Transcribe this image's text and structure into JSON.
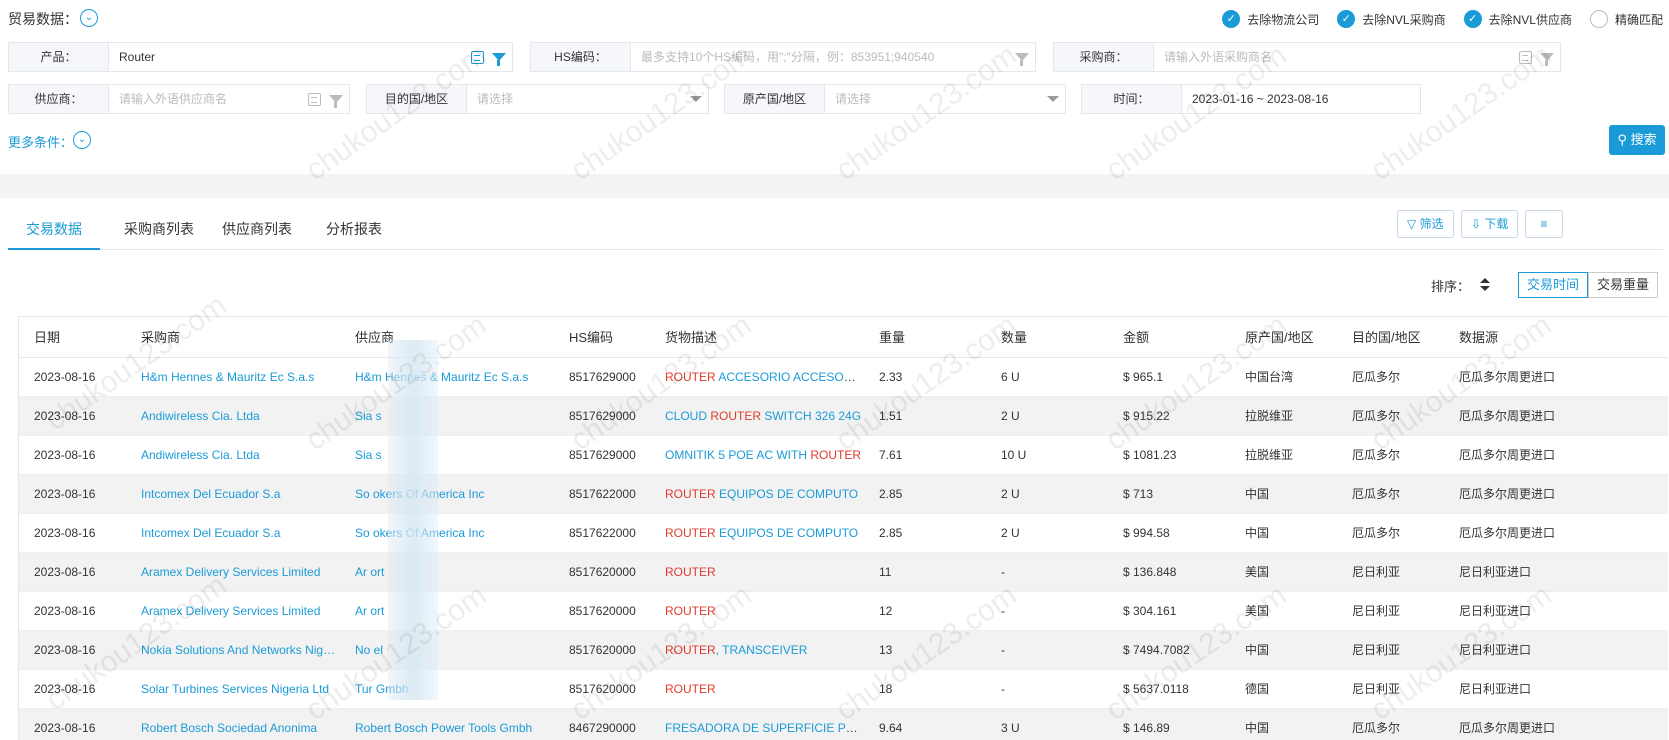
{
  "header": {
    "title": "贸易数据：",
    "options": [
      {
        "label": "去除物流公司",
        "checked": true
      },
      {
        "label": "去除NVL采购商",
        "checked": true
      },
      {
        "label": "去除NVL供应商",
        "checked": true
      },
      {
        "label": "精确匹配",
        "checked": false
      }
    ]
  },
  "filters": {
    "product": {
      "label": "产品：",
      "value": "Router"
    },
    "hs": {
      "label": "HS编码：",
      "placeholder": "最多支持10个HS编码，用\";\"分隔，例：853951;940540"
    },
    "buyer": {
      "label": "采购商：",
      "placeholder": "请输入外语采购商名"
    },
    "supplier": {
      "label": "供应商：",
      "placeholder": "请输入外语供应商名"
    },
    "destination": {
      "label": "目的国/地区",
      "placeholder": "请选择"
    },
    "origin": {
      "label": "原产国/地区",
      "placeholder": "请选择"
    },
    "time": {
      "label": "时间：",
      "value": "2023-01-16 ~ 2023-08-16"
    }
  },
  "more_conditions": "更多条件：",
  "search_label": "搜索",
  "tabs": [
    {
      "label": "交易数据",
      "active": true
    },
    {
      "label": "采购商列表",
      "active": false
    },
    {
      "label": "供应商列表",
      "active": false
    },
    {
      "label": "分析报表",
      "active": false
    }
  ],
  "toolbar": {
    "filter_label": "筛选",
    "download_label": "下载"
  },
  "sort": {
    "label": "排序：",
    "options": [
      "交易时间",
      "交易重量"
    ],
    "active": "交易时间"
  },
  "watermark": "chukou123.com",
  "table": {
    "columns": [
      "日期",
      "采购商",
      "供应商",
      "HS编码",
      "货物描述",
      "重量",
      "数量",
      "金额",
      "原产国/地区",
      "目的国/地区",
      "数据源"
    ],
    "rows": [
      {
        "date": "2023-08-16",
        "buyer": "H&m Hennes & Mauritz Ec S.a.s",
        "supplier": "H&m Hennes & Mauritz Ec S.a.s",
        "hs": "8517629000",
        "desc_kw": "ROUTER",
        "desc_rest": " ACCESORIO ACCESORIO",
        "weight": "2.33",
        "qty": "6 U",
        "amount": "$ 965.1",
        "origin": "中国台湾",
        "dest": "厄瓜多尔",
        "source": "厄瓜多尔周更进口"
      },
      {
        "date": "2023-08-16",
        "buyer": "Andiwireless Cia. Ltda",
        "supplier": "Sia                s",
        "hs": "8517629000",
        "desc_pre": "CLOUD ",
        "desc_kw": "ROUTER",
        "desc_rest": " SWITCH 326 24G",
        "weight": "1.51",
        "qty": "2 U",
        "amount": "$ 915.22",
        "origin": "拉脱维亚",
        "dest": "厄瓜多尔",
        "source": "厄瓜多尔周更进口"
      },
      {
        "date": "2023-08-16",
        "buyer": "Andiwireless Cia. Ltda",
        "supplier": "Sia                s",
        "hs": "8517629000",
        "desc_pre": "OMNITIK 5 POE AC WITH ",
        "desc_kw": "ROUTER",
        "desc_rest": "",
        "weight": "7.61",
        "qty": "10 U",
        "amount": "$ 1081.23",
        "origin": "拉脱维亚",
        "dest": "厄瓜多尔",
        "source": "厄瓜多尔周更进口"
      },
      {
        "date": "2023-08-16",
        "buyer": "Intcomex Del Ecuador S.a",
        "supplier": "So              okers Of America Inc",
        "hs": "8517622000",
        "desc_kw": "ROUTER",
        "desc_rest": " EQUIPOS DE COMPUTO",
        "weight": "2.85",
        "qty": "2 U",
        "amount": "$ 713",
        "origin": "中国",
        "dest": "厄瓜多尔",
        "source": "厄瓜多尔周更进口"
      },
      {
        "date": "2023-08-16",
        "buyer": "Intcomex Del Ecuador S.a",
        "supplier": "So              okers Of America Inc",
        "hs": "8517622000",
        "desc_kw": "ROUTER",
        "desc_rest": " EQUIPOS DE COMPUTO",
        "weight": "2.85",
        "qty": "2 U",
        "amount": "$ 994.58",
        "origin": "中国",
        "dest": "厄瓜多尔",
        "source": "厄瓜多尔周更进口"
      },
      {
        "date": "2023-08-16",
        "buyer": "Aramex Delivery Services Limited",
        "supplier": "Ar               ort",
        "hs": "8517620000",
        "desc_kw": "ROUTER",
        "desc_rest": "",
        "weight": "11",
        "qty": "-",
        "amount": "$ 136.848",
        "origin": "美国",
        "dest": "尼日利亚",
        "source": "尼日利亚进口"
      },
      {
        "date": "2023-08-16",
        "buyer": "Aramex Delivery Services Limited",
        "supplier": "Ar               ort",
        "hs": "8517620000",
        "desc_kw": "ROUTER",
        "desc_rest": "",
        "weight": "12",
        "qty": "-",
        "amount": "$ 304.161",
        "origin": "美国",
        "dest": "尼日利亚",
        "source": "尼日利亚进口"
      },
      {
        "date": "2023-08-16",
        "buyer": "Nokia Solutions And Networks Nigeria",
        "supplier": "No               el",
        "hs": "8517620000",
        "desc_kw": "ROUTER",
        "desc_rest": ", TRANSCEIVER",
        "weight": "13",
        "qty": "-",
        "amount": "$ 7494.7082",
        "origin": "中国",
        "dest": "尼日利亚",
        "source": "尼日利亚进口"
      },
      {
        "date": "2023-08-16",
        "buyer": "Solar Turbines Services Nigeria Ltd",
        "supplier": "Tur               Gmbh",
        "hs": "8517620000",
        "desc_kw": "ROUTER",
        "desc_rest": "",
        "weight": "18",
        "qty": "-",
        "amount": "$ 5637.0118",
        "origin": "德国",
        "dest": "尼日利亚",
        "source": "尼日利亚进口"
      },
      {
        "date": "2023-08-16",
        "buyer": "Robert Bosch Sociedad Anonima",
        "supplier": "Robert Bosch Power Tools Gmbh",
        "hs": "8467290000",
        "desc_kw": "",
        "desc_rest": "FRESADORA DE SUPERFICIE PLANA",
        "weight": "9.64",
        "qty": "3 U",
        "amount": "$ 146.89",
        "origin": "中国",
        "dest": "厄瓜多尔",
        "source": "厄瓜多尔周更进口"
      }
    ]
  }
}
